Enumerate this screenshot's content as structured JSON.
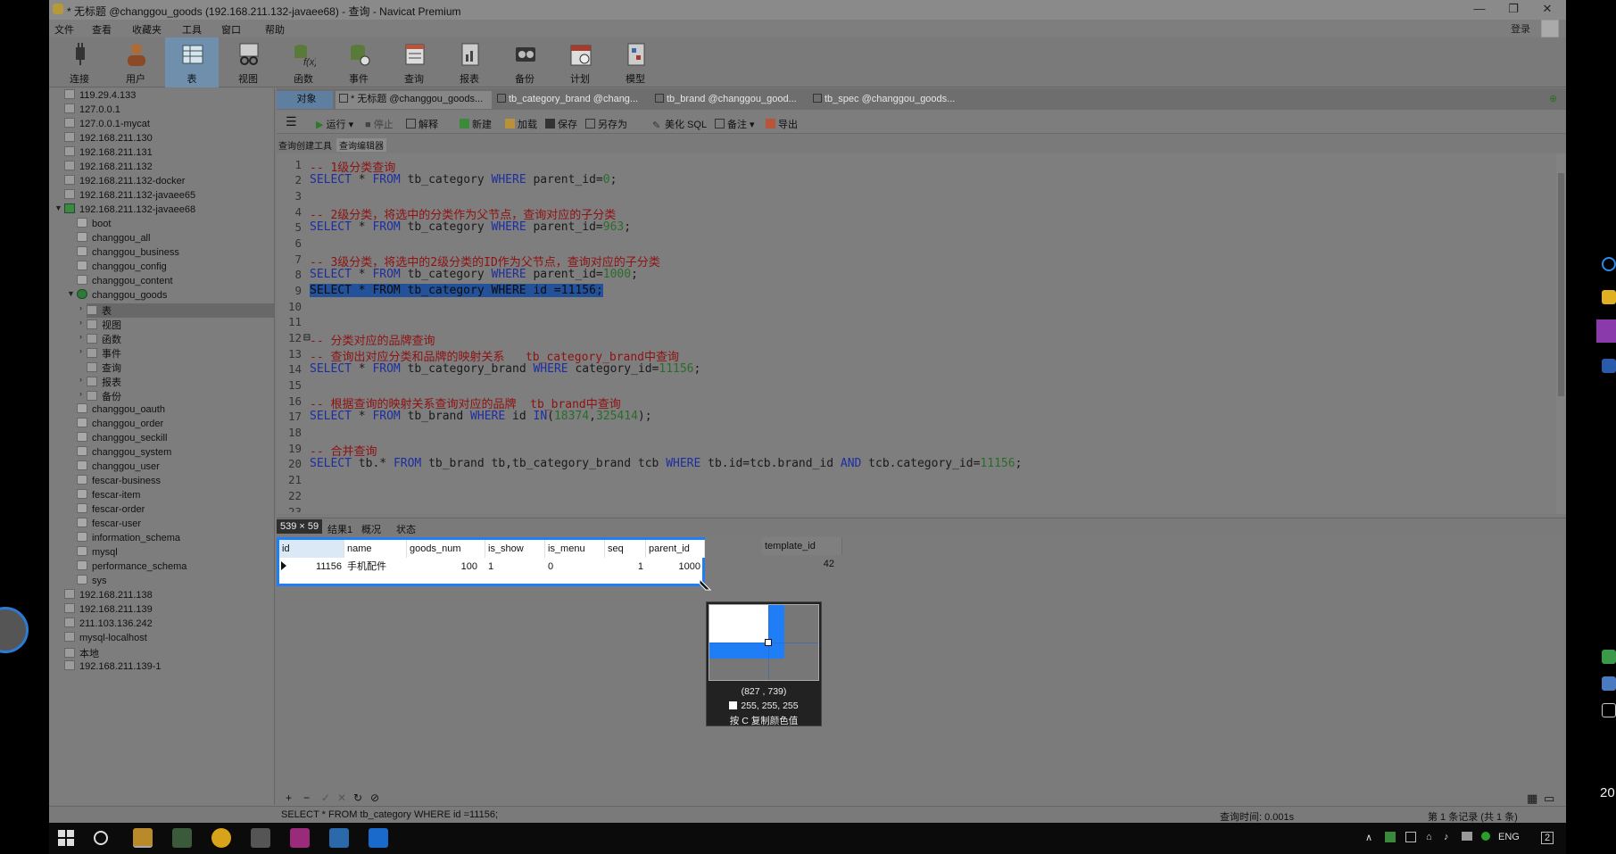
{
  "window": {
    "title": "* 无标题 @changgou_goods (192.168.211.132-javaee68) - 查询 - Navicat Premium",
    "controls": [
      "—",
      "❐",
      "✕"
    ]
  },
  "menu": {
    "items": [
      "文件",
      "查看",
      "收藏夹",
      "工具",
      "窗口",
      "帮助"
    ],
    "login": "登录"
  },
  "toolbar": {
    "buttons": [
      "连接",
      "用户",
      "表",
      "视图",
      "函数",
      "事件",
      "查询",
      "报表",
      "备份",
      "计划",
      "模型"
    ]
  },
  "tree": {
    "connections_top": [
      "119.29.4.133",
      "127.0.0.1",
      "127.0.0.1-mycat",
      "192.168.211.130",
      "192.168.211.131",
      "192.168.211.132",
      "192.168.211.132-docker",
      "192.168.211.132-javaee65",
      "192.168.211.132-javaee68"
    ],
    "databases_top": [
      "boot",
      "changgou_all",
      "changgou_business",
      "changgou_config",
      "changgou_content",
      "changgou_goods"
    ],
    "goods_children": [
      "表",
      "视图",
      "函数",
      "事件",
      "查询",
      "报表",
      "备份"
    ],
    "databases_bottom": [
      "changgou_oauth",
      "changgou_order",
      "changgou_seckill",
      "changgou_system",
      "changgou_user",
      "fescar-business",
      "fescar-item",
      "fescar-order",
      "fescar-user",
      "information_schema",
      "mysql",
      "performance_schema",
      "sys"
    ],
    "connections_bottom": [
      "192.168.211.138",
      "192.168.211.139",
      "211.103.136.242",
      "mysql-localhost",
      "本地",
      "192.168.211.139-1"
    ]
  },
  "tabs": {
    "object": "对象",
    "items": [
      "* 无标题 @changgou_goods...",
      "tb_category_brand @chang...",
      "tb_brand @changgou_good...",
      "tb_spec @changgou_goods..."
    ]
  },
  "query_toolbar": {
    "run": "运行",
    "stop": "停止",
    "explain": "解释",
    "new": "新建",
    "load": "加载",
    "save": "保存",
    "save_as": "另存为",
    "beautify": "美化 SQL",
    "comment": "备注",
    "export": "导出"
  },
  "subtabs": [
    "查询创建工具",
    "查询编辑器"
  ],
  "editor": {
    "line_numbers": [
      "1",
      "2",
      "3",
      "4",
      "5",
      "6",
      "7",
      "8",
      "9",
      "10",
      "11",
      "12",
      "13",
      "14",
      "15",
      "16",
      "17",
      "18",
      "19",
      "20",
      "21",
      "22",
      "23"
    ]
  },
  "result": {
    "size_badge": "539 × 59",
    "tabs": [
      "结果1",
      "概况",
      "状态"
    ],
    "columns": [
      "id",
      "name",
      "goods_num",
      "is_show",
      "is_menu",
      "seq",
      "parent_id",
      "template_id"
    ],
    "row": [
      "11156",
      "手机配件",
      "100",
      "1",
      "0",
      "1",
      "1000",
      "42"
    ]
  },
  "magnifier": {
    "coords": "(827 , 739)",
    "rgb": "255, 255, 255",
    "hint": "按 C 复制颜色值"
  },
  "bottom_tools": [
    "+",
    "−",
    "✓",
    "✕",
    "↻",
    "⊘"
  ],
  "status": {
    "sql": "SELECT * FROM tb_category WHERE id =11156;",
    "query_time": "查询时间: 0.001s",
    "records": "第 1 条记录 (共 1 条)"
  },
  "taskbar": {
    "lang": "ENG",
    "notif": "2"
  },
  "right_edge": {
    "text": "20"
  },
  "colors": {
    "selection": "#1f7ef5",
    "keyword": "#1d2ea0",
    "comment": "#8f1111",
    "number": "#2a6d2a",
    "highlight": "#23519a"
  }
}
